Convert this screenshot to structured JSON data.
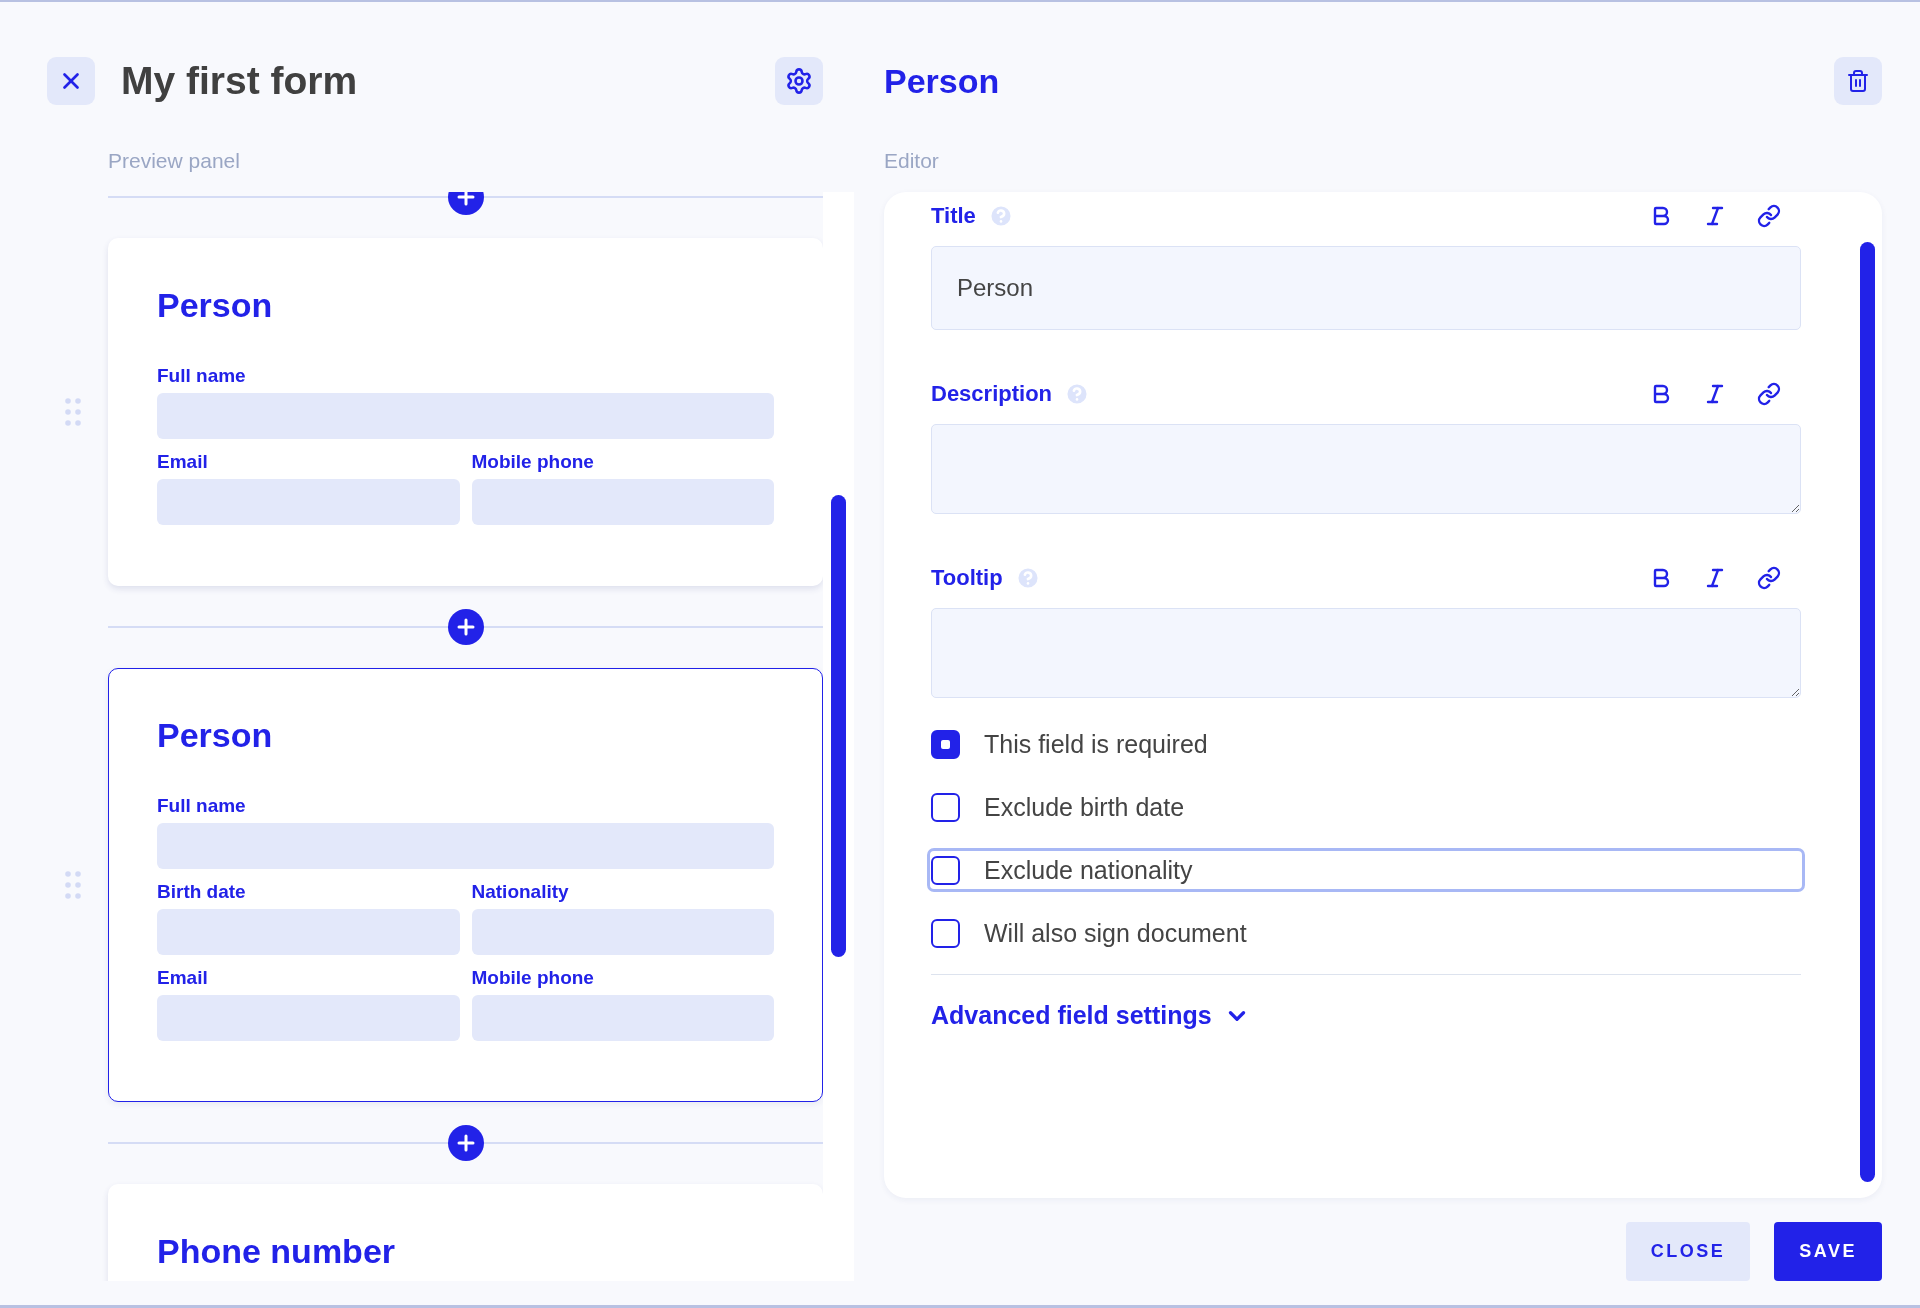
{
  "header": {
    "title": "My first form"
  },
  "preview": {
    "label": "Preview panel",
    "blocks": [
      {
        "title": "Person",
        "selected": false,
        "rows": [
          [
            {
              "label": "Full name"
            }
          ],
          [
            {
              "label": "Email"
            },
            {
              "label": "Mobile phone"
            }
          ]
        ]
      },
      {
        "title": "Person",
        "selected": true,
        "rows": [
          [
            {
              "label": "Full name"
            }
          ],
          [
            {
              "label": "Birth date"
            },
            {
              "label": "Nationality"
            }
          ],
          [
            {
              "label": "Email"
            },
            {
              "label": "Mobile phone"
            }
          ]
        ]
      },
      {
        "title": "Phone number",
        "selected": false
      }
    ]
  },
  "editor": {
    "title": "Person",
    "label": "Editor",
    "fields": [
      {
        "label": "Title",
        "kind": "input",
        "value": "Person"
      },
      {
        "label": "Description",
        "kind": "textarea"
      },
      {
        "label": "Tooltip",
        "kind": "textarea"
      }
    ],
    "options": [
      {
        "label": "This field is required",
        "checked": true,
        "focused": false
      },
      {
        "label": "Exclude birth date",
        "checked": false,
        "focused": false
      },
      {
        "label": "Exclude nationality",
        "checked": false,
        "focused": true
      },
      {
        "label": "Will also sign document",
        "checked": false,
        "focused": false
      }
    ],
    "advanced": {
      "label": "Advanced field settings",
      "expanded": false
    }
  },
  "buttons": [
    {
      "label": "CLOSE",
      "kind": "secondary"
    },
    {
      "label": "SAVE",
      "kind": "primary"
    }
  ]
}
